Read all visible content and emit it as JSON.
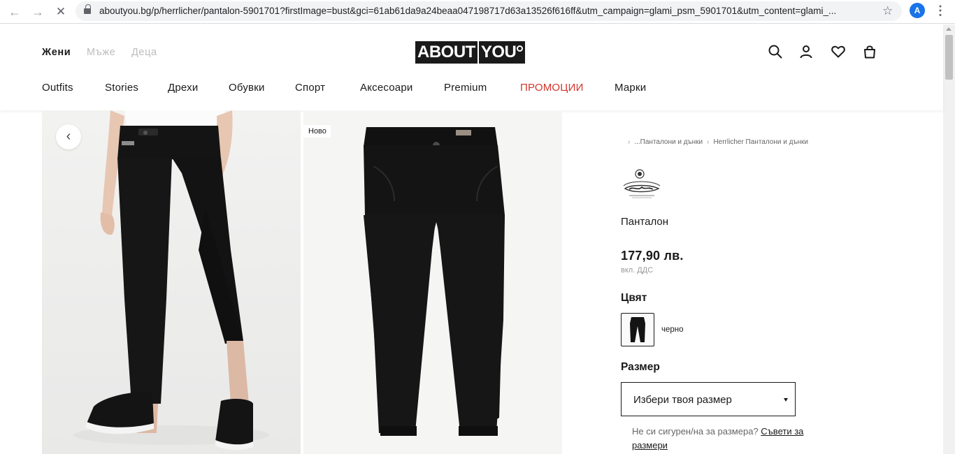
{
  "browser": {
    "url": "aboutyou.bg/p/herrlicher/pantalon-5901701?firstImage=bust&gci=61ab61da9a24beaa047198717d63a13526f616ff&utm_campaign=glami_psm_5901701&utm_content=glami_...",
    "profile_initial": "A"
  },
  "header": {
    "genders": [
      "Жени",
      "Мъже",
      "Деца"
    ],
    "logo_left": "ABOUT",
    "logo_right": "YOU",
    "categories": [
      "Outfits",
      "Stories",
      "Дрехи",
      "Обувки",
      "Спорт",
      "Аксесоари",
      "Premium",
      "ПРОМОЦИИ",
      "Марки"
    ]
  },
  "gallery": {
    "badge": "Ново"
  },
  "product": {
    "breadcrumb": [
      "...Панталони и дънки",
      "Herrlicher Панталони и дънки"
    ],
    "name": "Панталон",
    "price": "177,90 лв.",
    "vat_note": "вкл. ДДС",
    "color_heading": "Цвят",
    "color_name": "черно",
    "size_heading": "Размер",
    "size_placeholder": "Избери твоя размер",
    "size_hint_text": "Не си сигурен/на за размера?",
    "size_hint_link": "Съвети за размери"
  },
  "colors": {
    "promo": "#d2352b",
    "text": "#1a1a1a",
    "muted_gender": "#bdbdbd"
  }
}
